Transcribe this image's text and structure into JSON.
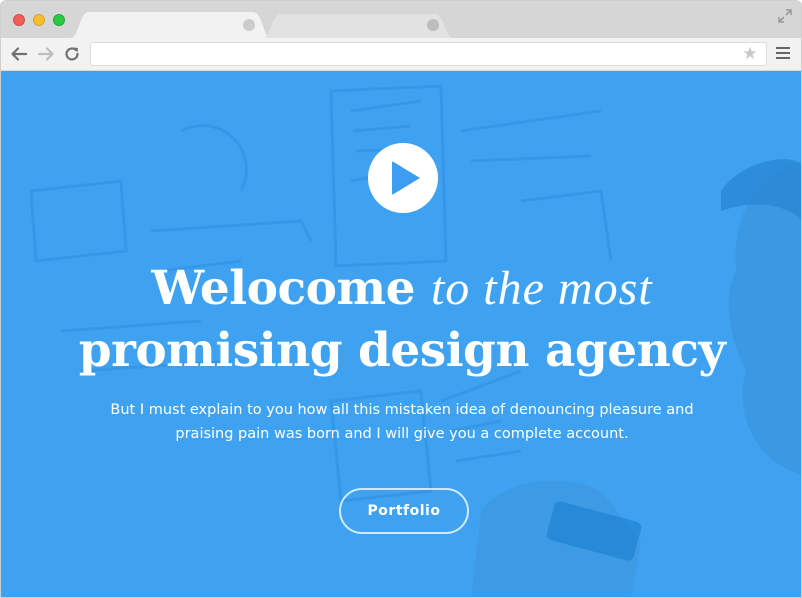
{
  "browser": {
    "tabs": [
      {
        "label": "",
        "state": "active"
      },
      {
        "label": "",
        "state": "inactive"
      }
    ],
    "address": {
      "value": "",
      "placeholder": ""
    },
    "icons": {
      "back": "arrow-left-icon",
      "forward": "arrow-right-icon",
      "reload": "reload-icon",
      "bookmark": "star-icon",
      "menu": "hamburger-menu-icon",
      "fullscreen": "expand-icon"
    }
  },
  "hero": {
    "headline_bold_1": "Welocome",
    "headline_italic": "to the most",
    "headline_bold_2": "promising design agency",
    "lead": "But I must explain to you how all this mistaken idea of denouncing pleasure and praising pain was born and I will give you a complete account.",
    "cta_label": "Portfolio",
    "overlay_color": "#2196f3"
  }
}
